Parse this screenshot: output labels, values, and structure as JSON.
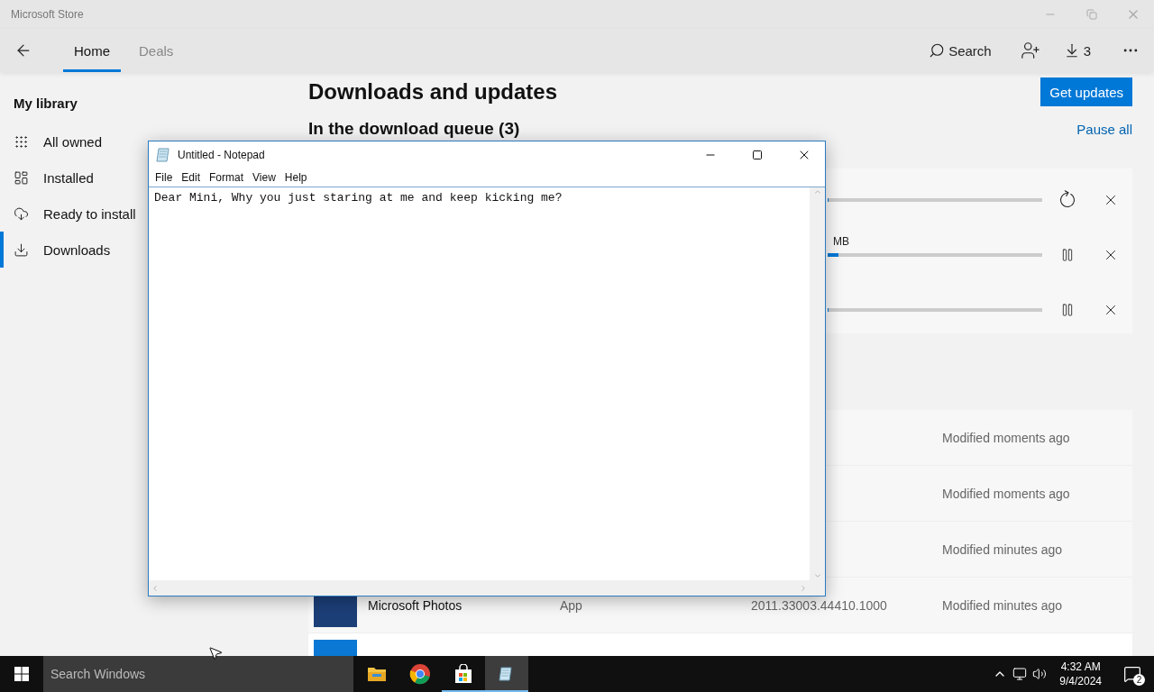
{
  "store_window": {
    "title": "Microsoft Store",
    "nav_tabs": [
      {
        "label": "Home",
        "selected": true
      },
      {
        "label": "Deals",
        "selected": false
      }
    ],
    "search_label": "Search",
    "downloads_count": "3"
  },
  "sidebar": {
    "heading": "My library",
    "items": [
      {
        "label": "All owned",
        "kind": "grid",
        "selected": false
      },
      {
        "label": "Installed",
        "kind": "tiles",
        "selected": false
      },
      {
        "label": "Ready to install",
        "kind": "cloud",
        "selected": false
      },
      {
        "label": "Downloads",
        "kind": "download",
        "selected": true
      }
    ]
  },
  "main": {
    "title": "Downloads and updates",
    "get_updates": "Get updates",
    "queue_heading": "In the download queue (3)",
    "pause_all": "Pause all",
    "queue": [
      {
        "kind": "retry",
        "level": 0
      },
      {
        "status": "MB",
        "kind": "pause",
        "level": 0.05
      },
      {
        "kind": "pause",
        "level": 0
      }
    ],
    "recent": [
      {
        "modified": "Modified moments ago"
      },
      {
        "modified": "Modified moments ago"
      },
      {
        "modified": "Modified minutes ago"
      },
      {
        "name": "Microsoft Photos",
        "type": "App",
        "version": "2011.33003.44410.1000",
        "modified": "Modified minutes ago",
        "color": "#1c3f78"
      },
      {
        "color": "#0a78d4"
      }
    ]
  },
  "notepad": {
    "title": "Untitled - Notepad",
    "menu": [
      "File",
      "Edit",
      "Format",
      "View",
      "Help"
    ],
    "text": "Dear Mini, Why you just staring at me and keep kicking me?"
  },
  "taskbar": {
    "search_placeholder": "Search Windows",
    "apps": [
      {
        "kind": "explorer",
        "running": false,
        "selected": false
      },
      {
        "kind": "chrome",
        "running": false,
        "selected": false
      },
      {
        "kind": "store",
        "running": true,
        "selected": false
      },
      {
        "kind": "notepad",
        "running": true,
        "selected": true
      }
    ],
    "time": "4:32 AM",
    "date": "9/4/2024",
    "notifications": "2"
  }
}
